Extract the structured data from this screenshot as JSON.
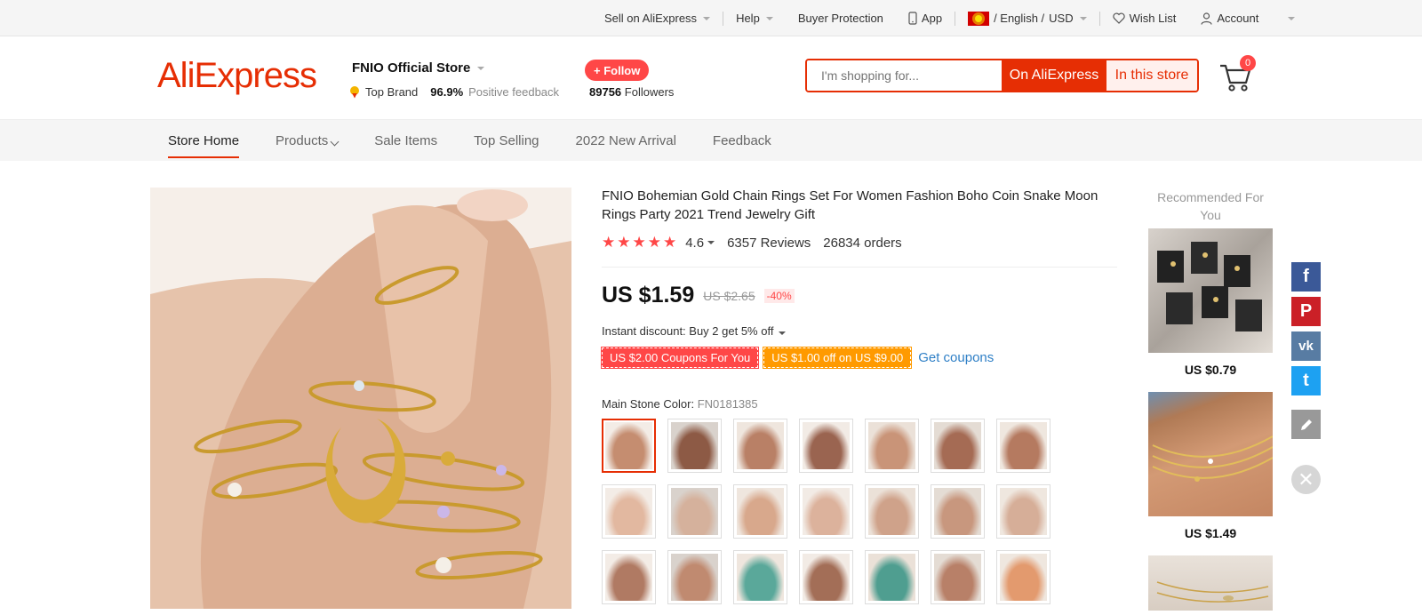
{
  "topbar": {
    "sell": "Sell on AliExpress",
    "help": "Help",
    "buyer_protection": "Buyer Protection",
    "app": "App",
    "language": "/ English /",
    "currency": "USD",
    "wish_list": "Wish List",
    "account": "Account"
  },
  "header": {
    "logo": "AliExpress",
    "store_name": "FNIO Official Store",
    "top_brand": "Top Brand",
    "feedback_pct": "96.9%",
    "feedback_label": "Positive feedback",
    "follow_label": "+ Follow",
    "followers_count": "89756",
    "followers_label": "Followers",
    "search_placeholder": "I'm shopping for...",
    "search_on_ali": "On AliExpress",
    "search_in_store": "In this store",
    "cart_count": "0"
  },
  "store_nav": {
    "tabs": [
      "Store Home",
      "Products",
      "Sale Items",
      "Top Selling",
      "2022 New Arrival",
      "Feedback"
    ]
  },
  "product": {
    "title": "FNIO Bohemian Gold Chain Rings Set For Women Fashion Boho Coin Snake Moon Rings Party 2021 Trend Jewelry Gift",
    "rating": "4.6",
    "stars": "★★★★★",
    "reviews": "6357 Reviews",
    "orders": "26834 orders",
    "price": "US $1.59",
    "original_price": "US $2.65",
    "discount": "-40%",
    "instant_discount": "Instant discount: Buy 2 get 5% off",
    "coupon_1": "US $2.00 Coupons For You",
    "coupon_2": "US $1.00 off on US $9.00",
    "get_coupons": "Get coupons",
    "color_label": "Main Stone Color:",
    "color_value": "FN0181385",
    "swatch_count": 21,
    "selected_swatch": 1
  },
  "recommended": {
    "title": "Recommended For You",
    "items": [
      {
        "price": "US $0.79"
      },
      {
        "price": "US $1.49"
      },
      {
        "price": ""
      }
    ]
  },
  "share": {
    "facebook": "f",
    "pinterest": "P",
    "vk": "vk",
    "twitter": "t",
    "close": "✕"
  },
  "colors": {
    "brand_red": "#e62e04",
    "accent_red": "#ff4747",
    "coupon_orange": "#ff9a00",
    "link_blue": "#2e7fc6"
  }
}
